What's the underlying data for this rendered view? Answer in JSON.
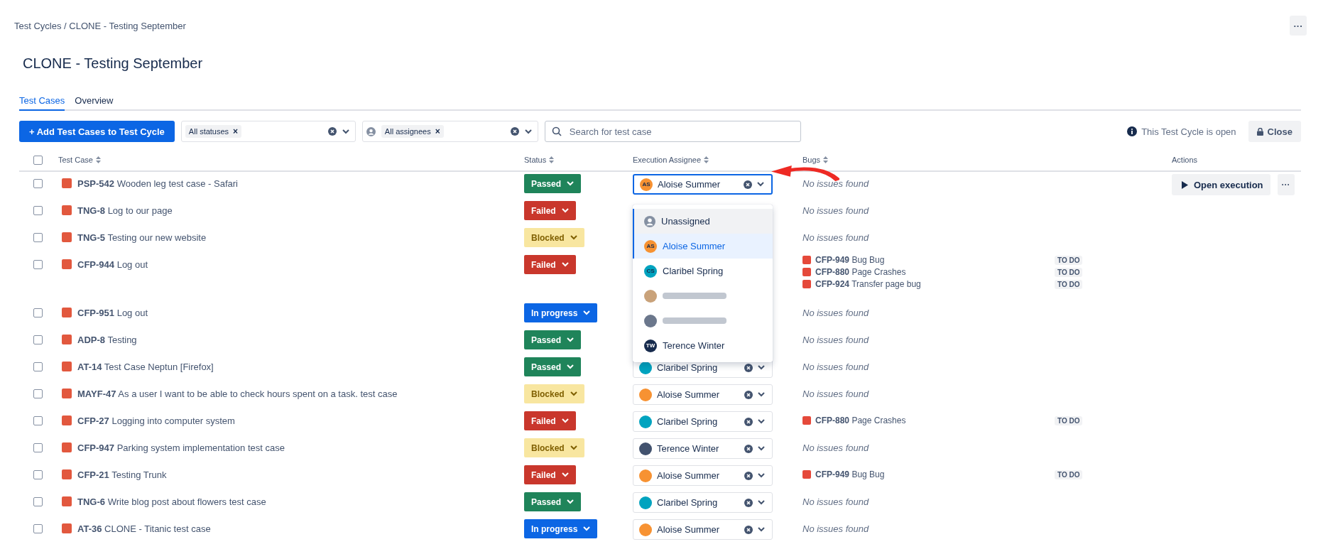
{
  "breadcrumb": "Test Cycles / CLONE - Testing September",
  "more_button": "···",
  "title": "CLONE - Testing September",
  "tabs": [
    {
      "label": "Test Cases",
      "selected": true
    },
    {
      "label": "Overview",
      "selected": false
    }
  ],
  "toolbar": {
    "add_button": "+ Add Test Cases to Test Cycle",
    "status_filter": {
      "tag": "All statuses",
      "remove": "×"
    },
    "assignee_filter": {
      "tag": "All assignees",
      "remove": "×"
    },
    "search": {
      "placeholder": "Search for test case"
    },
    "info": "This Test Cycle is open",
    "close_button": "Close"
  },
  "table": {
    "select_all_checked": false,
    "columns": [
      {
        "label": "Test Case",
        "sortable": true
      },
      {
        "label": "Status",
        "sortable": true
      },
      {
        "label": "Execution Assignee",
        "sortable": true
      },
      {
        "label": "Bugs",
        "sortable": true
      },
      {
        "label": "Actions",
        "sortable": false
      }
    ],
    "rows": [
      {
        "key": "PSP-542",
        "name": "Wooden leg test case - Safari",
        "status": {
          "label": "Passed",
          "kind": "passed"
        },
        "checked": false,
        "assignee": {
          "name": "Aloise Summer",
          "initials": "AS",
          "color": "#f79232",
          "menu_open": true
        },
        "bugs_empty": "No issues found",
        "actions": {
          "open": "Open execution",
          "more": "···"
        }
      },
      {
        "key": "TNG-8",
        "name": "Log to our page",
        "status": {
          "label": "Failed",
          "kind": "failed"
        },
        "checked": false,
        "bugs_empty": "No issues found"
      },
      {
        "key": "TNG-5",
        "name": "Testing our new website",
        "status": {
          "label": "Blocked",
          "kind": "blocked"
        },
        "checked": false,
        "bugs_empty": "No issues found"
      },
      {
        "key": "CFP-944",
        "name": "Log out",
        "status": {
          "label": "Failed",
          "kind": "failed"
        },
        "checked": false,
        "bugs": [
          {
            "key": "CFP-949",
            "title": "Bug Bug",
            "status": "TO DO"
          },
          {
            "key": "CFP-880",
            "title": "Page Crashes",
            "status": "TO DO"
          },
          {
            "key": "CFP-924",
            "title": "Transfer page bug",
            "status": "TO DO"
          }
        ]
      },
      {
        "key": "CFP-951",
        "name": "Log out",
        "status": {
          "label": "In progress",
          "kind": "progress"
        },
        "checked": false,
        "bugs_empty": "No issues found"
      },
      {
        "key": "ADP-8",
        "name": "Testing",
        "status": {
          "label": "Passed",
          "kind": "passed"
        },
        "checked": false,
        "bugs_empty": "No issues found"
      },
      {
        "key": "AT-14",
        "name": "Test Case Neptun [Firefox]",
        "status": {
          "label": "Passed",
          "kind": "passed"
        },
        "checked": false,
        "assignee": {
          "name": "Claribel Spring",
          "color": "#00a3bf",
          "menu_open": false
        },
        "bugs_empty": "No issues found"
      },
      {
        "key": "MAYF-47",
        "name": "As a user I want to be able to check hours spent on a task. test case",
        "status": {
          "label": "Blocked",
          "kind": "blocked"
        },
        "checked": false,
        "assignee": {
          "name": "Aloise Summer",
          "color": "#f79232",
          "menu_open": false
        },
        "bugs_empty": "No issues found"
      },
      {
        "key": "CFP-27",
        "name": "Logging into computer system",
        "status": {
          "label": "Failed",
          "kind": "failed"
        },
        "checked": false,
        "assignee": {
          "name": "Claribel Spring",
          "color": "#00a3bf",
          "menu_open": false
        },
        "bugs": [
          {
            "key": "CFP-880",
            "title": "Page Crashes",
            "status": "TO DO"
          }
        ]
      },
      {
        "key": "CFP-947",
        "name": "Parking system implementation test case",
        "status": {
          "label": "Blocked",
          "kind": "blocked"
        },
        "checked": false,
        "assignee": {
          "name": "Terence Winter",
          "color": "#42526e",
          "menu_open": false
        },
        "bugs_empty": "No issues found"
      },
      {
        "key": "CFP-21",
        "name": "Testing Trunk",
        "status": {
          "label": "Failed",
          "kind": "failed"
        },
        "checked": false,
        "assignee": {
          "name": "Aloise Summer",
          "color": "#f79232",
          "menu_open": false
        },
        "bugs": [
          {
            "key": "CFP-949",
            "title": "Bug Bug",
            "status": "TO DO"
          }
        ]
      },
      {
        "key": "TNG-6",
        "name": "Write blog post about flowers test case",
        "status": {
          "label": "Passed",
          "kind": "passed"
        },
        "checked": false,
        "assignee": {
          "name": "Claribel Spring",
          "color": "#00a3bf",
          "menu_open": false
        },
        "bugs_empty": "No issues found"
      },
      {
        "key": "AT-36",
        "name": "CLONE - Titanic test case",
        "status": {
          "label": "In progress",
          "kind": "progress"
        },
        "checked": false,
        "assignee": {
          "name": "Aloise Summer",
          "color": "#f79232",
          "menu_open": false
        },
        "bugs_empty": "No issues found"
      }
    ]
  },
  "assignee_menu": [
    {
      "kind": "unassigned",
      "name": "Unassigned",
      "selected": false,
      "highlighted": true
    },
    {
      "kind": "user",
      "name": "Aloise Summer",
      "initials": "AS",
      "color": "#f79232",
      "selected": true,
      "highlighted": false
    },
    {
      "kind": "user",
      "name": "Claribel Spring",
      "initials": "CS",
      "color": "#00a3bf",
      "selected": false,
      "highlighted": false
    },
    {
      "kind": "hidden",
      "color": "#c9a27a",
      "selected": false,
      "highlighted": false
    },
    {
      "kind": "hidden",
      "color": "#6b778c",
      "selected": false,
      "highlighted": false
    },
    {
      "kind": "user",
      "name": "Terence Winter",
      "initials": "TW",
      "color": "#172b4d",
      "selected": false,
      "highlighted": false
    }
  ]
}
